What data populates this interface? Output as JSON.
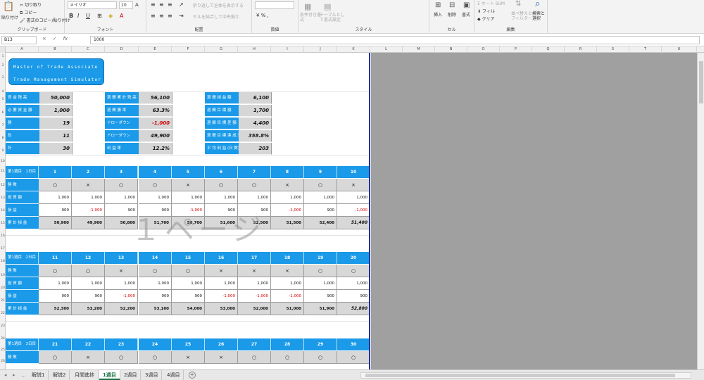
{
  "ribbon": {
    "clipboard": {
      "paste": "貼り付け",
      "cut": "切り取り",
      "copy": "コピー",
      "format_painter": "書式のコピー/貼り付け",
      "label": "クリップボード"
    },
    "font": {
      "name": "メイリオ",
      "size": "10",
      "bold": "B",
      "italic": "I",
      "underline": "U",
      "label": "フォント"
    },
    "alignment": {
      "wrap": "折り返して全体を表示する",
      "merge": "セルを結合して中央揃え",
      "label": "配置"
    },
    "number": {
      "label": "数値"
    },
    "styles": {
      "conditional": "条件付き書式",
      "table": "テーブルとして書式設定",
      "label": "スタイル"
    },
    "cells": {
      "insert": "挿入",
      "delete": "削除",
      "format": "書式",
      "label": "セル"
    },
    "editing": {
      "autosum": "オート SUM",
      "fill": "フィル",
      "clear": "クリア",
      "sort": "並べ替えとフィルター",
      "find": "検索と選択",
      "label": "編集"
    }
  },
  "formula_bar": {
    "name_box": "B13",
    "cancel": "×",
    "enter": "✓",
    "fx": "fx",
    "value": "1000"
  },
  "columns": [
    "A",
    "B",
    "C",
    "D",
    "E",
    "F",
    "G",
    "H",
    "I",
    "J",
    "K",
    "L",
    "M",
    "N",
    "O",
    "P",
    "Q",
    "R",
    "S",
    "T",
    "U"
  ],
  "rows": [
    "1",
    "2",
    "3",
    "4",
    "5",
    "6",
    "7",
    "8",
    "9",
    "10",
    "11",
    "12",
    "13",
    "14",
    "15",
    "16",
    "17",
    "18",
    "19",
    "20",
    "21",
    "22",
    "23",
    "24",
    "25",
    "26"
  ],
  "title": {
    "line1": "Master of Trade Associate",
    "line2": "Trade Management Simulator"
  },
  "summary": {
    "left": [
      {
        "label": "資 金 残 高",
        "value": "50,000"
      },
      {
        "label": "必 要 資 金 額",
        "value": "1,000"
      },
      {
        "label": "勝",
        "value": "19"
      },
      {
        "label": "負",
        "value": "11"
      },
      {
        "label": "計",
        "value": "30"
      }
    ],
    "mid": [
      {
        "label": "週 間 累 計 残 高",
        "value": "56,100",
        "neg": false
      },
      {
        "label": "週 間 勝 率",
        "value": "63.3%",
        "neg": false
      },
      {
        "label": "ドローダウン",
        "value": "-1,000",
        "neg": true
      },
      {
        "label": "ドローダウン",
        "value": "49,900",
        "neg": false
      },
      {
        "label": "利 益 率",
        "value": "12.2%",
        "neg": false
      }
    ],
    "right": [
      {
        "label": "週 間 損 益 額",
        "value": "6,100"
      },
      {
        "label": "週 間 目 標 額",
        "value": "1,700"
      },
      {
        "label": "週 間 目 標 差 額",
        "value": "4,400"
      },
      {
        "label": "週 間 目 標 達 成 率",
        "value": "358.8%"
      },
      {
        "label": "平 均 利 益 (日 数)",
        "value": "203"
      }
    ]
  },
  "watermark": "１ページ",
  "weeks": [
    {
      "header": "第1週目　1日目",
      "rows": {
        "result": {
          "label": "勝 敗",
          "values": [
            "○",
            "×",
            "○",
            "○",
            "×",
            "○",
            "○",
            "×",
            "○",
            "×"
          ]
        },
        "funds": {
          "label": "投 資 額",
          "values": [
            "1,000",
            "1,000",
            "1,000",
            "1,000",
            "1,000",
            "1,000",
            "1,000",
            "1,000",
            "1,000",
            "1,000"
          ]
        },
        "pnl": {
          "label": "損 益",
          "values": [
            "900",
            "-1,000",
            "900",
            "900",
            "-1,000",
            "900",
            "900",
            "-1,000",
            "900",
            "-1,000"
          ]
        },
        "total": {
          "label": "累 計 損 益",
          "values": [
            "50,900",
            "49,900",
            "50,800",
            "51,700",
            "50,700",
            "51,600",
            "52,500",
            "51,500",
            "52,400",
            "51,400"
          ]
        }
      },
      "days": [
        "1",
        "2",
        "3",
        "4",
        "5",
        "6",
        "7",
        "8",
        "9",
        "10"
      ]
    },
    {
      "header": "第1週目　2日目",
      "rows": {
        "result": {
          "label": "勝 敗",
          "values": [
            "○",
            "○",
            "×",
            "○",
            "○",
            "×",
            "×",
            "×",
            "○",
            "○"
          ]
        },
        "funds": {
          "label": "投 資 額",
          "values": [
            "1,000",
            "1,000",
            "1,000",
            "1,000",
            "1,000",
            "1,000",
            "1,000",
            "1,000",
            "1,000",
            "1,000"
          ]
        },
        "pnl": {
          "label": "損 益",
          "values": [
            "900",
            "900",
            "-1,000",
            "900",
            "900",
            "-1,000",
            "-1,000",
            "-1,000",
            "900",
            "900"
          ]
        },
        "total": {
          "label": "累 計 損 益",
          "values": [
            "52,300",
            "53,200",
            "52,200",
            "53,100",
            "54,000",
            "53,000",
            "52,000",
            "51,000",
            "51,900",
            "52,800"
          ]
        }
      },
      "days": [
        "11",
        "12",
        "13",
        "14",
        "15",
        "16",
        "17",
        "18",
        "19",
        "20"
      ]
    },
    {
      "header": "第1週目　3日目",
      "rows": {
        "result": {
          "label": "勝 敗",
          "values": [
            "○",
            "×",
            "○",
            "○",
            "×",
            "×",
            "○",
            "○",
            "○",
            "○"
          ]
        }
      },
      "days": [
        "21",
        "22",
        "23",
        "24",
        "25",
        "26",
        "27",
        "28",
        "29",
        "30"
      ]
    }
  ],
  "tabs": [
    "解説1",
    "解説2",
    "月間進捗",
    "1週目",
    "2週目",
    "3週目",
    "4週目"
  ],
  "active_tab": "1週目"
}
